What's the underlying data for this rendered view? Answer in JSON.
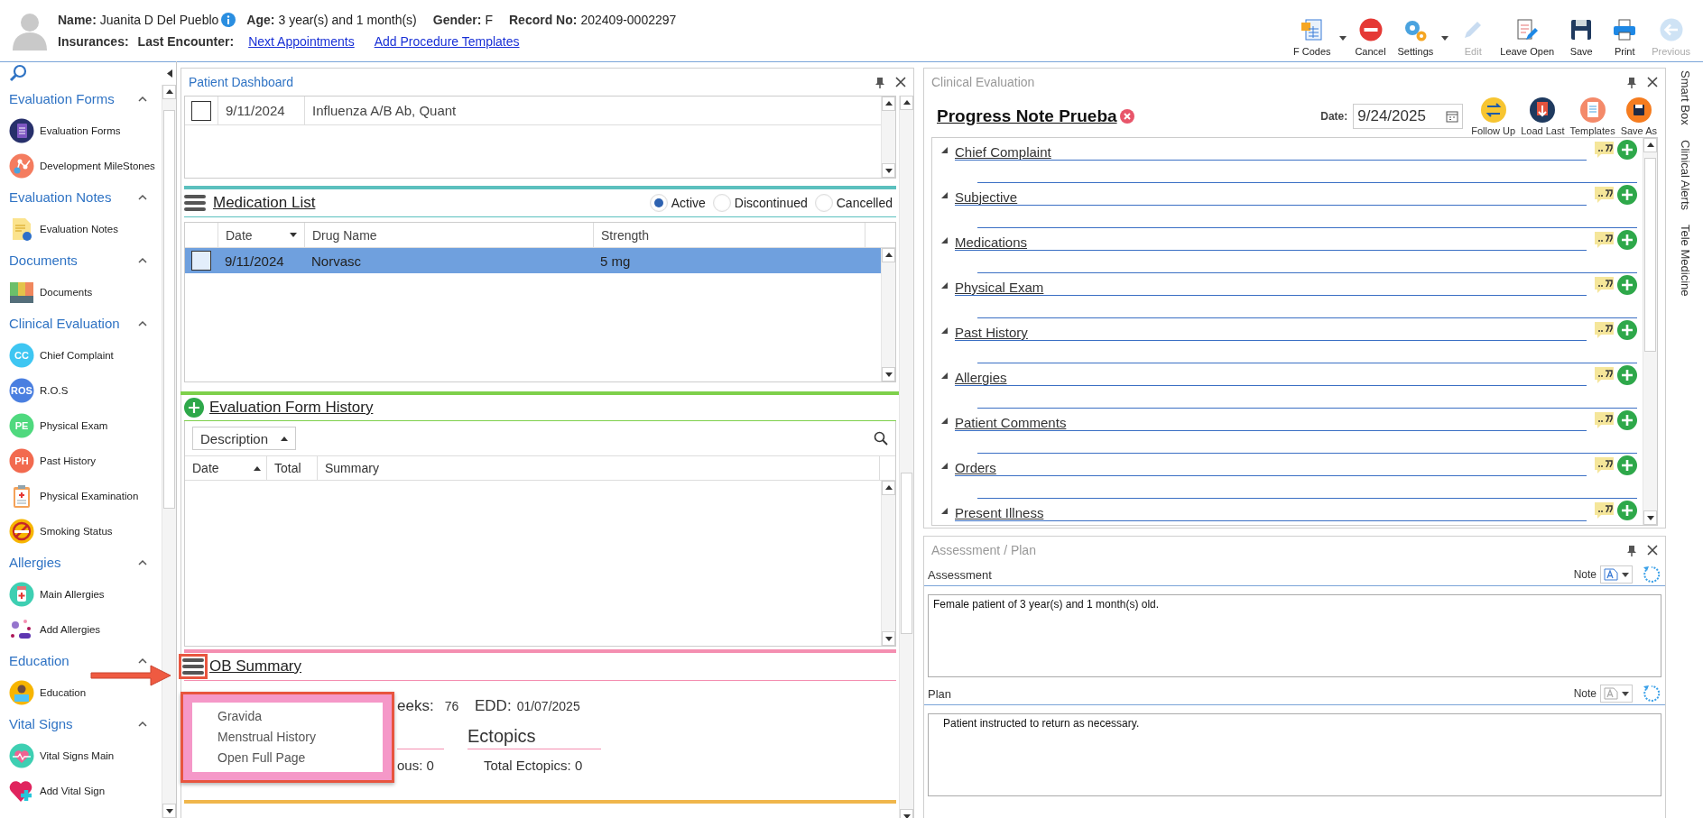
{
  "header": {
    "fields": [
      {
        "label": "Name:",
        "value": "Juanita D Del Pueblo",
        "info": true
      },
      {
        "label": "Age:",
        "value": "3 year(s) and 1 month(s)",
        "info": false
      },
      {
        "label": "Gender:",
        "value": "F",
        "info": false
      },
      {
        "label": "Record No:",
        "value": "202409-0002297",
        "info": false
      }
    ],
    "labels": [
      "Insurances:",
      "Last Encounter:"
    ],
    "links": [
      "Next Appointments",
      "Add Procedure Templates"
    ]
  },
  "toolbar": [
    {
      "label": "F Codes",
      "kind": "fcodes",
      "dropdown": true,
      "disabled": false
    },
    {
      "label": "Cancel",
      "kind": "cancel",
      "dropdown": false,
      "disabled": false
    },
    {
      "label": "Settings",
      "kind": "settings",
      "dropdown": true,
      "disabled": false
    },
    {
      "label": "Edit",
      "kind": "edit",
      "dropdown": false,
      "disabled": true
    },
    {
      "label": "Leave Open",
      "kind": "leaveopen",
      "dropdown": false,
      "disabled": false
    },
    {
      "label": "Save",
      "kind": "save",
      "dropdown": false,
      "disabled": false
    },
    {
      "label": "Print",
      "kind": "print",
      "dropdown": false,
      "disabled": false
    },
    {
      "label": "Previous",
      "kind": "previous",
      "dropdown": false,
      "disabled": true
    }
  ],
  "sidebar": {
    "groups": [
      {
        "title": "Evaluation Forms",
        "expanded": true,
        "items": [
          {
            "label": "Evaluation Forms",
            "kind": "form"
          },
          {
            "label": "Development MileStones",
            "kind": "network"
          }
        ]
      },
      {
        "title": "Evaluation Notes",
        "expanded": true,
        "items": [
          {
            "label": "Evaluation Notes",
            "kind": "note"
          }
        ]
      },
      {
        "title": "Documents",
        "expanded": true,
        "items": [
          {
            "label": "Documents",
            "kind": "binders"
          }
        ]
      },
      {
        "title": "Clinical Evaluation",
        "expanded": true,
        "items": [
          {
            "label": "Chief Complaint",
            "kind": "letters",
            "badge": "CC",
            "color": "#3ec6f2"
          },
          {
            "label": "R.O.S",
            "kind": "letters",
            "badge": "ROS",
            "color": "#4a7fe0"
          },
          {
            "label": "Physical Exam",
            "kind": "letters",
            "badge": "PE",
            "color": "#4fd97e"
          },
          {
            "label": "Past History",
            "kind": "letters",
            "badge": "PH",
            "color": "#f26a4f"
          },
          {
            "label": "Physical Examination",
            "kind": "clipboard"
          },
          {
            "label": "Smoking Status",
            "kind": "nosmoking"
          }
        ]
      },
      {
        "title": "Allergies",
        "expanded": true,
        "items": [
          {
            "label": "Main Allergies",
            "kind": "bottle"
          },
          {
            "label": "Add Allergies",
            "kind": "pills"
          }
        ]
      },
      {
        "title": "Education",
        "expanded": true,
        "items": [
          {
            "label": "Education",
            "kind": "reader"
          }
        ]
      },
      {
        "title": "Vital Signs",
        "expanded": true,
        "items": [
          {
            "label": "Vital Signs Main",
            "kind": "heartbeat"
          },
          {
            "label": "Add Vital Sign",
            "kind": "heartplus"
          }
        ]
      }
    ]
  },
  "dashboard": {
    "title": "Patient Dashboard",
    "labs": [
      {
        "checked": false,
        "date": "9/11/2024",
        "name": "Influenza A/B Ab, Quant"
      }
    ],
    "medication_list": {
      "title": "Medication List",
      "filters": [
        {
          "label": "Active",
          "selected": true
        },
        {
          "label": "Discontinued",
          "selected": false
        },
        {
          "label": "Cancelled",
          "selected": false
        }
      ],
      "columns": [
        "Date",
        "Drug Name",
        "Strength"
      ],
      "rows": [
        {
          "selected": true,
          "date": "9/11/2024",
          "drug": "Norvasc",
          "strength": "5 mg"
        }
      ]
    },
    "evaluation_form_history": {
      "title": "Evaluation Form History",
      "group_by": "Description",
      "columns": [
        "Date",
        "Total",
        "Summary"
      ]
    },
    "ob_summary": {
      "title": "OB Summary",
      "weeks_label": "eeks:",
      "weeks": "76",
      "edd_label": "EDD:",
      "edd": "01/07/2025",
      "ectopics_title": "Ectopics",
      "fragment": "ous: 0",
      "total_ectopics": "Total Ectopics: 0",
      "menu": [
        "Gravida",
        "Menstrual History",
        "Open Full Page"
      ]
    }
  },
  "clinical_evaluation": {
    "title": "Clinical Evaluation",
    "note_title": "Progress Note Prueba",
    "date_label": "Date:",
    "date": "9/24/2025",
    "actions": [
      {
        "label": "Follow Up",
        "kind": "swap"
      },
      {
        "label": "Load Last",
        "kind": "load"
      },
      {
        "label": "Templates",
        "kind": "clipboard"
      },
      {
        "label": "Save As",
        "kind": "save"
      }
    ],
    "sections": [
      "Chief Complaint",
      "Subjective",
      "Medications",
      "Physical Exam",
      "Past History",
      "Allergies",
      "Patient Comments",
      "Orders",
      "Present Illness"
    ]
  },
  "assessment_plan": {
    "title": "Assessment / Plan",
    "fields": [
      {
        "label": "Assessment",
        "note_label": "Note",
        "disabled": false,
        "text": "Female patient of 3 year(s) and 1 month(s) old."
      },
      {
        "label": "Plan",
        "note_label": "Note",
        "disabled": true,
        "text": "Patient instructed to return as necessary."
      }
    ]
  },
  "side_tabs": [
    "Smart Box",
    "Clinical Alerts",
    "Tele Medicine"
  ]
}
